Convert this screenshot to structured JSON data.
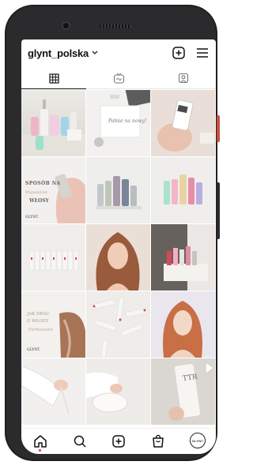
{
  "profile": {
    "username": "glynt_polska",
    "avatar_text": "GLYNT"
  },
  "tabs": [
    {
      "name": "grid-icon",
      "active": true
    },
    {
      "name": "reels-icon",
      "active": false
    },
    {
      "name": "tagged-icon",
      "active": false
    }
  ],
  "posts": [
    {
      "id": "post-1",
      "text": ""
    },
    {
      "id": "post-2",
      "text": "Pałnie na nowy!"
    },
    {
      "id": "post-3",
      "text": ""
    },
    {
      "id": "post-4",
      "text": "SPOSÓB NA",
      "text2": "Wypadanie",
      "text3": "WŁOSY",
      "brand": "GLYNT."
    },
    {
      "id": "post-5",
      "text": ""
    },
    {
      "id": "post-6",
      "text": ""
    },
    {
      "id": "post-7",
      "text": ""
    },
    {
      "id": "post-8",
      "text": ""
    },
    {
      "id": "post-9",
      "text": ""
    },
    {
      "id": "post-10",
      "text": "JAK DBAĆ",
      "text2": "O WŁOSY",
      "text3": "Farbowane",
      "brand": "GLYNT."
    },
    {
      "id": "post-11",
      "text": ""
    },
    {
      "id": "post-12",
      "text": ""
    },
    {
      "id": "post-13",
      "text": ""
    },
    {
      "id": "post-14",
      "text": ""
    },
    {
      "id": "post-15",
      "text": "TTR"
    }
  ],
  "nav": [
    "home-icon",
    "search-icon",
    "new-post-icon",
    "shop-icon",
    "profile-avatar"
  ],
  "colors": {
    "accent": "#e2314c",
    "shell": "#1f1f21",
    "side_button": "#c9503f"
  }
}
